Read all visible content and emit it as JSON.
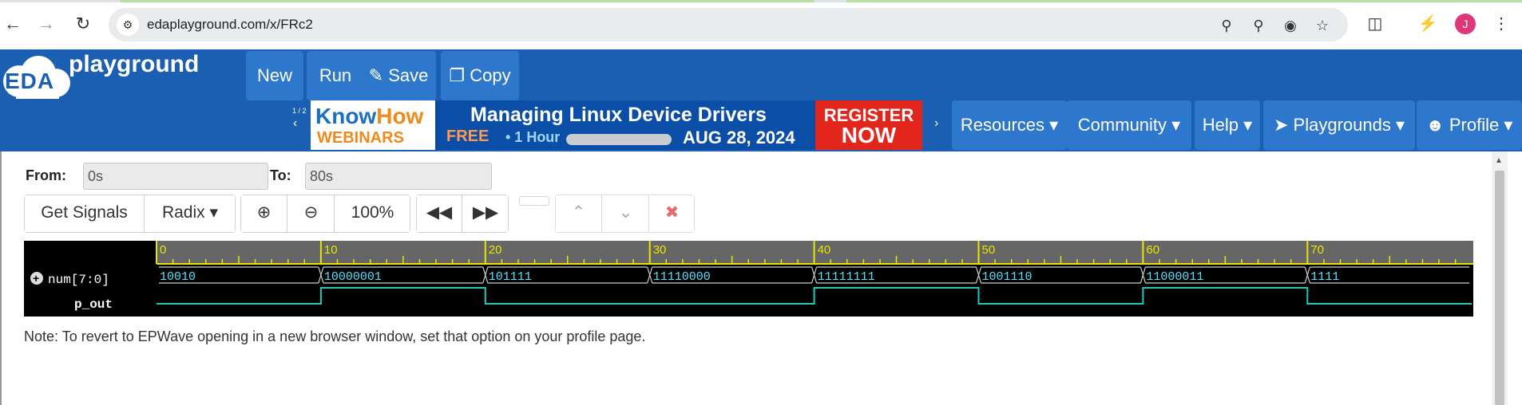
{
  "browser": {
    "url": "edaplayground.com/x/FRc2",
    "avatar_letter": "J"
  },
  "header": {
    "logo_eda": "EDA",
    "logo_playground": "playground",
    "buttons": {
      "new": "New",
      "run": "Run",
      "save": "Save",
      "copy": "Copy"
    },
    "nav": {
      "resources": "Resources",
      "community": "Community",
      "help": "Help",
      "playgrounds": "Playgrounds",
      "profile": "Profile"
    },
    "ad": {
      "counter": "1 / 2",
      "know": "Know",
      "how": "How",
      "webinars": "WEBINARS",
      "title": "Managing Linux Device Drivers",
      "free": "FREE",
      "hour": "• 1 Hour",
      "date": "AUG 28, 2024",
      "register": "REGISTER",
      "now": "NOW"
    }
  },
  "wave": {
    "from_label": "From:",
    "from_value": "0s",
    "to_label": "To:",
    "to_value": "80s",
    "get_signals": "Get Signals",
    "radix": "Radix",
    "zoom": "100%",
    "ticks": [
      "0",
      "10",
      "20",
      "30",
      "40",
      "50",
      "60",
      "70"
    ],
    "signals": [
      {
        "name": "num[7:0]",
        "values": [
          "10010",
          "10000001",
          "101111",
          "11110000",
          "11111111",
          "1001110",
          "11000011",
          "1111"
        ]
      },
      {
        "name": "p_out",
        "levels": [
          0,
          1,
          0,
          0,
          1,
          0,
          1,
          0
        ]
      }
    ],
    "colors": {
      "value_text": "#4fe3ff",
      "wave_line": "#21c9b8",
      "ruler_tick": "#e6e600",
      "ruler_bg": "#666666"
    },
    "note": "Note: To revert to EPWave opening in a new browser window, set that option on your profile page."
  }
}
